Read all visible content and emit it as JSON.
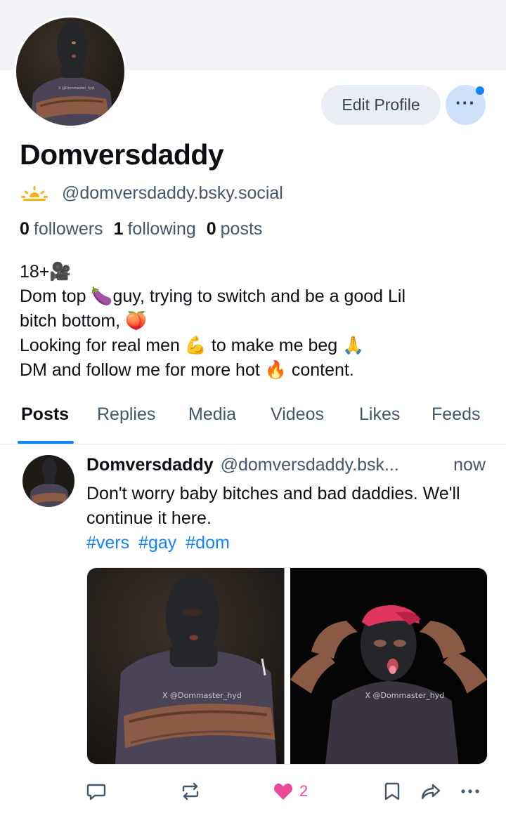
{
  "profile": {
    "display_name": "Domversdaddy",
    "handle": "@domversdaddy.bsky.social",
    "edit_label": "Edit Profile",
    "more_label": "···",
    "stats": {
      "followers_count": "0",
      "followers_label": "followers",
      "following_count": "1",
      "following_label": "following",
      "posts_count": "0",
      "posts_label": "posts"
    },
    "bio_lines": [
      "18+🎥",
      "Dom top 🍆guy, trying to switch and be a good Lil",
      "bitch bottom, 🍑",
      "Looking for real men 💪 to make me beg 🙏",
      "DM and follow me for more hot 🔥 content."
    ]
  },
  "tabs": [
    "Posts",
    "Replies",
    "Media",
    "Videos",
    "Likes",
    "Feeds"
  ],
  "active_tab": "Posts",
  "post": {
    "author": "Domversdaddy",
    "handle": "@domversdaddy.bsk...",
    "time": "now",
    "text": "Don't worry baby bitches and bad daddies. We'll continue it here.",
    "hashtags": [
      "#vers",
      "#gay",
      "#dom"
    ],
    "image_watermarks": [
      "X  @Dommaster_hyd",
      "X  @Dommaster_hyd"
    ],
    "like_count": "2"
  },
  "colors": {
    "accent": "#1083fe",
    "like": "#ec4899",
    "muted_text": "#42576c",
    "banner": "#f1f3f6"
  },
  "icons": [
    "sun-icon",
    "reply-icon",
    "repost-icon",
    "heart-icon",
    "bookmark-icon",
    "share-icon",
    "more-icon"
  ]
}
